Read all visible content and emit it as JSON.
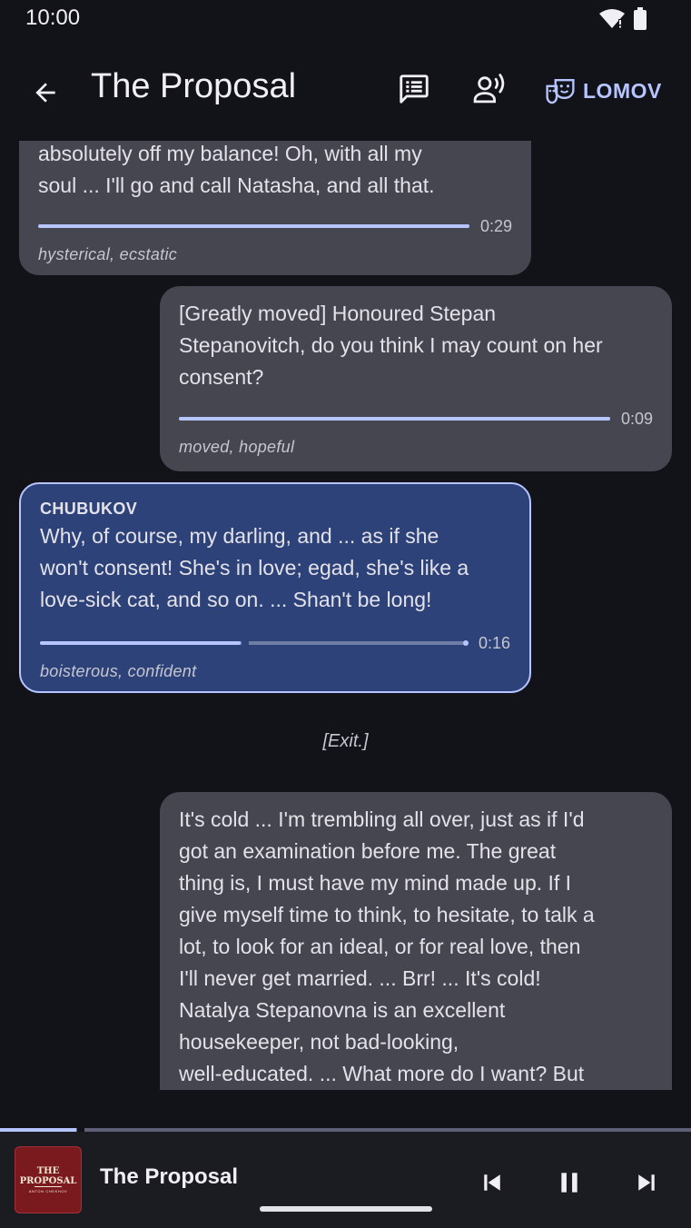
{
  "status": {
    "time": "10:00"
  },
  "header": {
    "title": "The Proposal",
    "role_label": "LOMOV",
    "icons": [
      "arrow-back-icon",
      "script-icon",
      "voice-icon",
      "theater-masks-icon"
    ]
  },
  "messages": [
    {
      "side": "left",
      "speaker": "",
      "lines": [
        "absolutely off my balance! Oh, with all my",
        "soul ... I'll go and call Natasha, and all that."
      ],
      "duration": "0:29",
      "progress": 1.0,
      "emotion": "hysterical, ecstatic"
    },
    {
      "side": "right",
      "speaker": "",
      "lines": [
        "[Greatly moved] Honoured Stepan",
        "Stepanovitch, do you think I may count on her",
        "consent?"
      ],
      "duration": "0:09",
      "progress": 1.0,
      "emotion": "moved, hopeful"
    },
    {
      "side": "left",
      "speaker": "CHUBUKOV",
      "lines": [
        "Why, of course, my darling, and ... as if she",
        "won't consent! She's in love; egad, she's like a",
        "love-sick cat, and so on. ... Shan't be long!"
      ],
      "duration": "0:16",
      "progress": 0.47,
      "emotion": "boisterous, confident",
      "active": true
    },
    {
      "side": "right",
      "speaker": "",
      "lines": [
        "It's cold ... I'm trembling all over, just as if I'd",
        "got an examination before me. The great",
        "thing is, I must have my mind made up. If I",
        "give myself time to think, to hesitate, to talk a",
        "lot, to look for an ideal, or for real love, then",
        "I'll never get married. ... Brr! ... It's cold!",
        "Natalya Stepanovna is an excellent",
        "housekeeper, not bad-looking,",
        "well-educated. ... What more do I want? But"
      ],
      "duration": "",
      "emotion": ""
    }
  ],
  "stage_direction": "[Exit.]",
  "player": {
    "title": "The Proposal",
    "cover_title": "THE PROPOSAL",
    "cover_author": "ANTON CHEKHOV",
    "progress": 0.11,
    "colors": {
      "accent": "#b6c4ff",
      "cover": "#7a1a1f"
    }
  }
}
